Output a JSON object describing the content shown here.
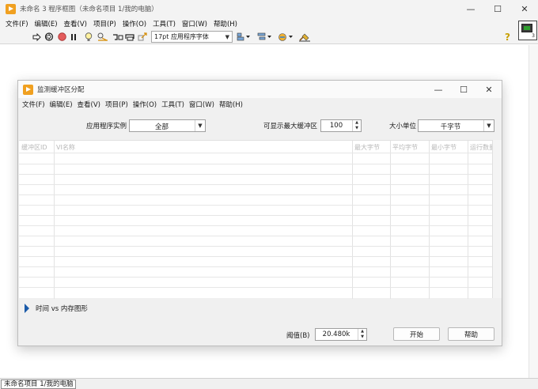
{
  "main_window": {
    "title": "未命名 3 程序框图（未命名项目 1/我的电脑）",
    "controls": {
      "minimize": "—",
      "maximize": "☐",
      "close": "✕"
    },
    "menu": [
      "文件(F)",
      "编辑(E)",
      "查看(V)",
      "项目(P)",
      "操作(O)",
      "工具(T)",
      "窗口(W)",
      "帮助(H)"
    ],
    "toolbar": {
      "font": "17pt 应用程序字体",
      "icons": [
        "run-arrow-icon",
        "run-continuous-icon",
        "abort-icon",
        "pause-icon",
        "highlight-execution-icon",
        "retain-wire-values-icon",
        "step-into-icon",
        "step-over-icon",
        "step-out-icon",
        "font-select",
        "align-objects-icon",
        "distribute-objects-icon",
        "reorder-icon",
        "clean-up-diagram-icon"
      ]
    },
    "context_help": "?",
    "vi_icon_number": "3",
    "status_text": "未命名项目 1/我的电脑"
  },
  "dialog": {
    "title": "监测缓冲区分配",
    "controls": {
      "minimize": "—",
      "maximize": "☐",
      "close": "✕"
    },
    "menu": [
      "文件(F)",
      "编辑(E)",
      "查看(V)",
      "项目(P)",
      "操作(O)",
      "工具(T)",
      "窗口(W)",
      "帮助(H)"
    ],
    "app_instance": {
      "label": "应用程序实例",
      "value": "全部"
    },
    "max_buffers": {
      "label": "可显示最大缓冲区",
      "value": "100"
    },
    "size_unit": {
      "label": "大小单位",
      "value": "千字节"
    },
    "table": {
      "columns": [
        "缓冲区ID",
        "VI名称",
        "最大字节",
        "平均字节",
        "最小字节",
        "运行数量"
      ],
      "rows": []
    },
    "graph_toggle": "时间 vs 内存图形",
    "threshold": {
      "label": "阈值(B)",
      "value": "20.480k"
    },
    "start_button": "开始",
    "help_button": "帮助"
  }
}
